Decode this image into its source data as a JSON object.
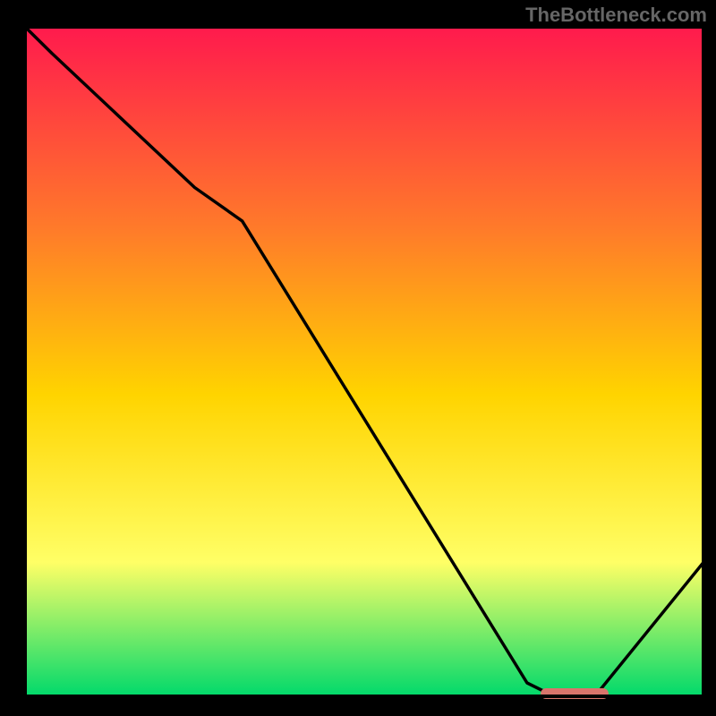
{
  "watermark": "TheBottleneck.com",
  "chart_data": {
    "type": "line",
    "title": "",
    "xlabel": "",
    "ylabel": "",
    "xlim": [
      0,
      100
    ],
    "ylim": [
      0,
      100
    ],
    "background_gradient": {
      "top": "#ff1a4d",
      "upper_mid": "#ff7a2a",
      "mid": "#ffd400",
      "lower_mid": "#ffff66",
      "bottom": "#00d96b"
    },
    "series": [
      {
        "name": "bottleneck-curve",
        "x": [
          0,
          4,
          25,
          32,
          74,
          78,
          84,
          100
        ],
        "y": [
          100,
          96,
          76,
          71,
          2,
          0,
          0,
          20
        ]
      }
    ],
    "marker": {
      "name": "optimal-zone-marker",
      "x_start": 76,
      "x_end": 86,
      "y": 0.4,
      "color": "#d9746b"
    }
  }
}
